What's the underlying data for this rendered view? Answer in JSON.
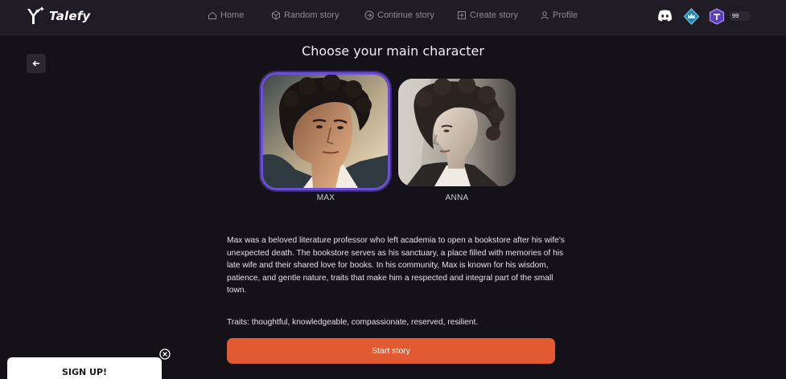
{
  "brand": {
    "name": "Talefy"
  },
  "nav": {
    "home": "Home",
    "random": "Random story",
    "continue": "Continue story",
    "create": "Create story",
    "profile": "Profile"
  },
  "header_icons": [
    "discord-icon",
    "crown-icon",
    "token-icon"
  ],
  "credits": "99",
  "page": {
    "title": "Choose your main character"
  },
  "characters": [
    {
      "name": "MAX",
      "selected": true
    },
    {
      "name": "ANNA",
      "selected": false
    }
  ],
  "description": "Max was a beloved literature professor who left academia to open a bookstore after his wife's unexpected death. The bookstore serves as his sanctuary, a place filled with memories of his late wife and their shared love for books. In his community, Max is known for his wisdom, patience, and gentle nature, traits that make him a respected and integral part of the small town.",
  "traits": "Traits: thoughtful, knowledgeable, compassionate, reserved, resilient.",
  "start_button": "Start story",
  "signup": {
    "label": "SIGN UP!"
  },
  "colors": {
    "background": "#141218",
    "navbar": "#1f1c26",
    "accent_button": "#e05b32",
    "selected_border": "#6b4fd6"
  }
}
